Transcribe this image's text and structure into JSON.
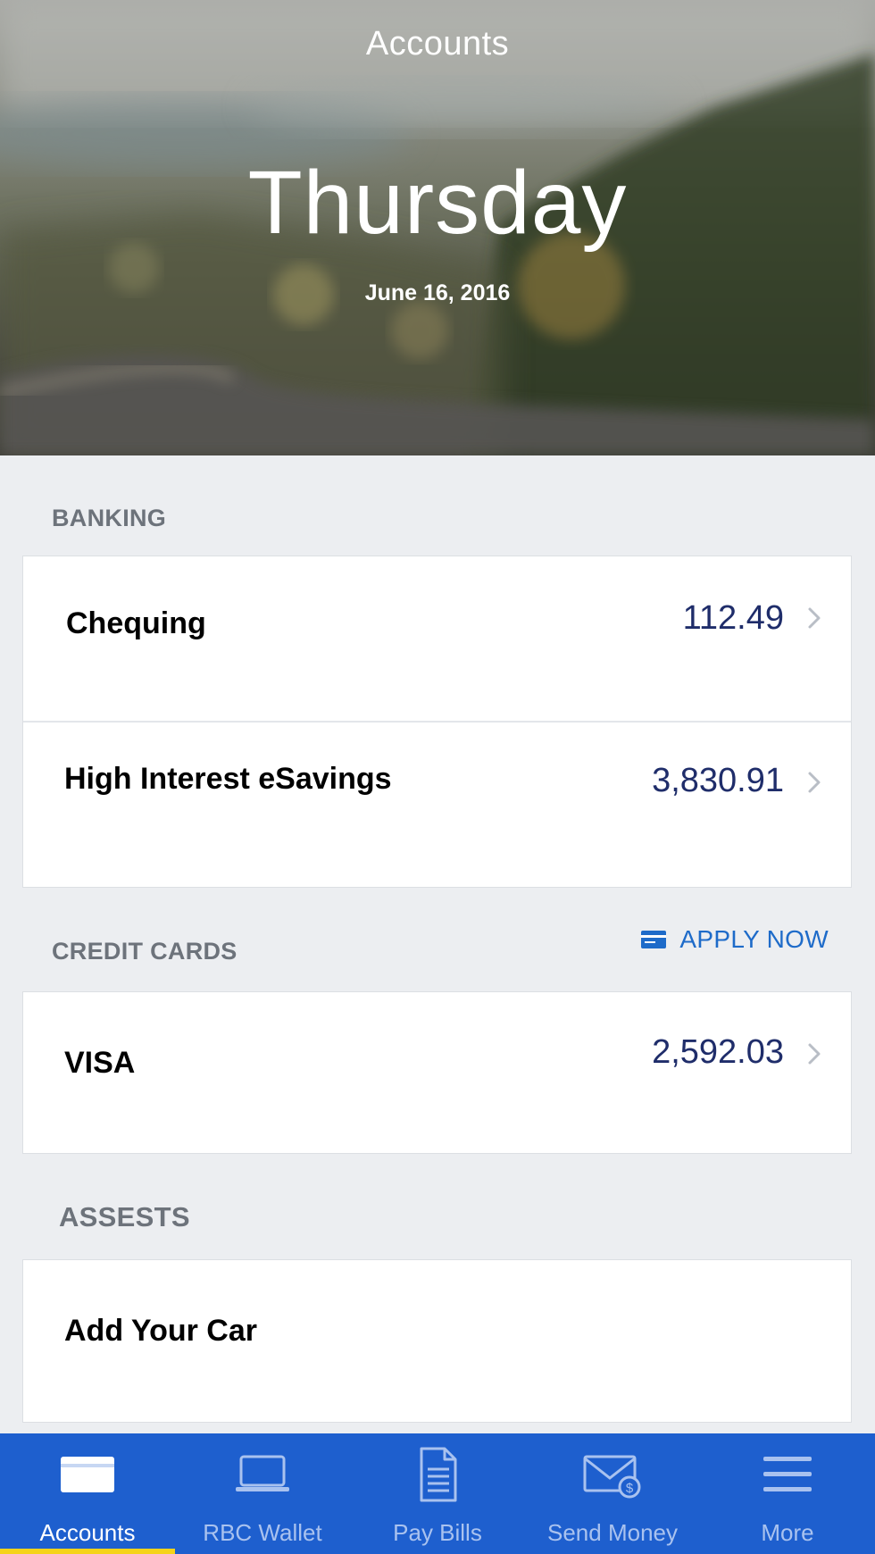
{
  "header": {
    "title": "Accounts",
    "day": "Thursday",
    "date": "June 16, 2016"
  },
  "banking": {
    "label": "BANKING",
    "accounts": [
      {
        "name": "Chequing",
        "amount": "112.49"
      },
      {
        "name": "High Interest eSavings",
        "amount": "3,830.91"
      }
    ]
  },
  "credit_cards": {
    "label": "CREDIT CARDS",
    "apply_label": "APPLY NOW",
    "accounts": [
      {
        "name": "VISA",
        "amount": "2,592.03"
      }
    ]
  },
  "assets": {
    "label": "ASSESTS",
    "items": [
      {
        "name": "Add Your Car"
      }
    ]
  },
  "tabbar": {
    "active": "Accounts",
    "tabs": [
      {
        "label": "Accounts",
        "icon": "card-icon"
      },
      {
        "label": "RBC Wallet",
        "icon": "laptop-icon"
      },
      {
        "label": "Pay Bills",
        "icon": "document-icon"
      },
      {
        "label": "Send Money",
        "icon": "envelope-money-icon"
      },
      {
        "label": "More",
        "icon": "hamburger-icon"
      }
    ]
  },
  "colors": {
    "tabbar_bg": "#1e5fce",
    "active_indicator": "#f5d31a",
    "amount_text": "#1f2d6a",
    "link_blue": "#1e6bc9"
  }
}
